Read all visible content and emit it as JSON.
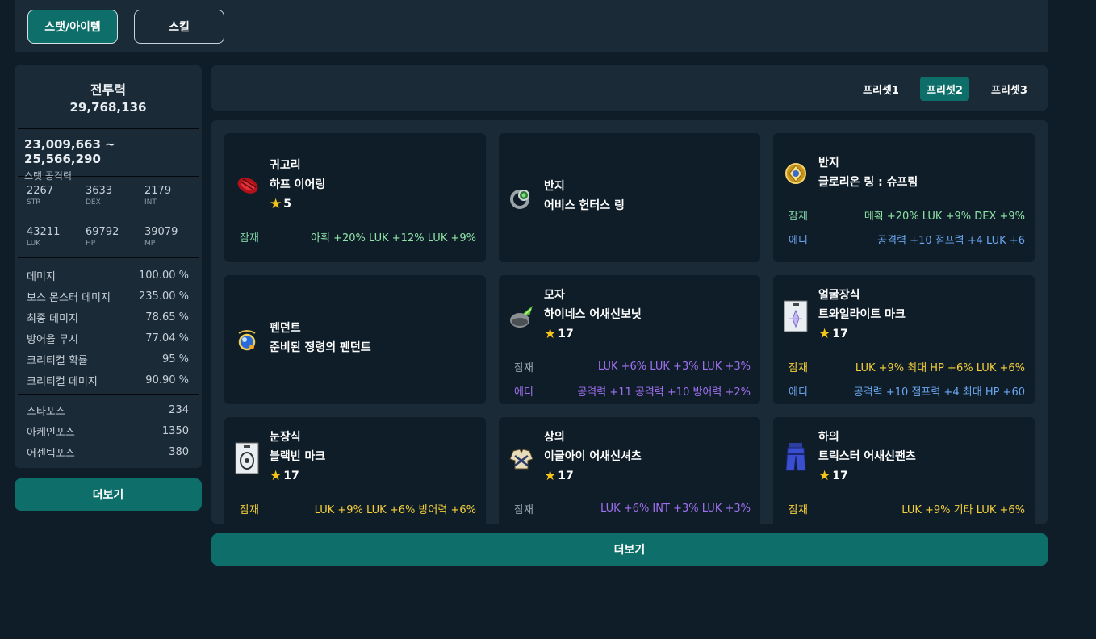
{
  "tabs": {
    "stat_item": "스탯/아이템",
    "skill": "스킬"
  },
  "stats": {
    "combat_power_label": "전투력",
    "combat_power": "29,768,136",
    "attack_range": "23,009,663 ~ 25,566,290",
    "attack_range_label": "스탯 공격력",
    "base": [
      {
        "value": "2267",
        "label": "STR"
      },
      {
        "value": "3633",
        "label": "DEX"
      },
      {
        "value": "2179",
        "label": "INT"
      },
      {
        "value": "43211",
        "label": "LUK"
      },
      {
        "value": "69792",
        "label": "HP"
      },
      {
        "value": "39079",
        "label": "MP"
      }
    ],
    "details": [
      {
        "label": "데미지",
        "value": "100.00 %"
      },
      {
        "label": "보스 몬스터 데미지",
        "value": "235.00 %"
      },
      {
        "label": "최종 데미지",
        "value": "78.65 %"
      },
      {
        "label": "방어율 무시",
        "value": "77.04 %"
      },
      {
        "label": "크리티컬 확률",
        "value": "95 %"
      },
      {
        "label": "크리티컬 데미지",
        "value": "90.90 %"
      }
    ],
    "forces": [
      {
        "label": "스타포스",
        "value": "234"
      },
      {
        "label": "아케인포스",
        "value": "1350"
      },
      {
        "label": "어센틱포스",
        "value": "380"
      }
    ],
    "more_label": "더보기"
  },
  "presets": [
    "프리셋1",
    "프리셋2",
    "프리셋3"
  ],
  "active_preset": "프리셋2",
  "items": [
    {
      "type": "귀고리",
      "name": "하프 이어링",
      "star": "5",
      "icon": "earring-icon",
      "potential_label": "잠재",
      "potential": "아획 +20% LUK +12% LUK +9%"
    },
    {
      "type": "반지",
      "name": "어비스 헌터스 링",
      "icon": "ring-icon"
    },
    {
      "type": "반지",
      "name": "글로리온 링 : 슈프림",
      "icon": "gold-ring-icon",
      "potential_label": "잠재",
      "potential": "메획 +20% LUK +9% DEX +9%",
      "additional_label": "에디",
      "additional": "공격력 +10 점프력 +4 LUK +6"
    },
    {
      "type": "펜던트",
      "name": "준비된 정령의 펜던트",
      "icon": "pendant-icon"
    },
    {
      "type": "모자",
      "name": "하이네스 어새신보닛",
      "star": "17",
      "icon": "hat-icon",
      "potential_label": "잠재",
      "potential": "LUK +6% LUK +3% LUK +3%",
      "additional_label": "에디",
      "additional": "공격력 +11 공격력 +10 방어력 +2%"
    },
    {
      "type": "얼굴장식",
      "name": "트와일라이트 마크",
      "star": "17",
      "icon": "face-accessory-icon",
      "potential_label": "잠재",
      "potential": "LUK +9% 최대 HP +6% LUK +6%",
      "additional_label": "에디",
      "additional": "공격력 +10 점프력 +4 최대 HP +60"
    },
    {
      "type": "눈장식",
      "name": "블랙빈 마크",
      "star": "17",
      "icon": "eye-accessory-icon",
      "potential_label": "잠재",
      "potential": "LUK +9% LUK +6% 방어력 +6%"
    },
    {
      "type": "상의",
      "name": "이글아이 어새신셔츠",
      "star": "17",
      "icon": "top-icon",
      "potential_label": "잠재",
      "potential": "LUK +6% INT +3% LUK +3%"
    },
    {
      "type": "하의",
      "name": "트릭스터 어새신팬츠",
      "star": "17",
      "icon": "bottom-icon",
      "potential_label": "잠재",
      "potential": "LUK +9% 기타 LUK +6%"
    }
  ],
  "items_more_label": "더보기"
}
